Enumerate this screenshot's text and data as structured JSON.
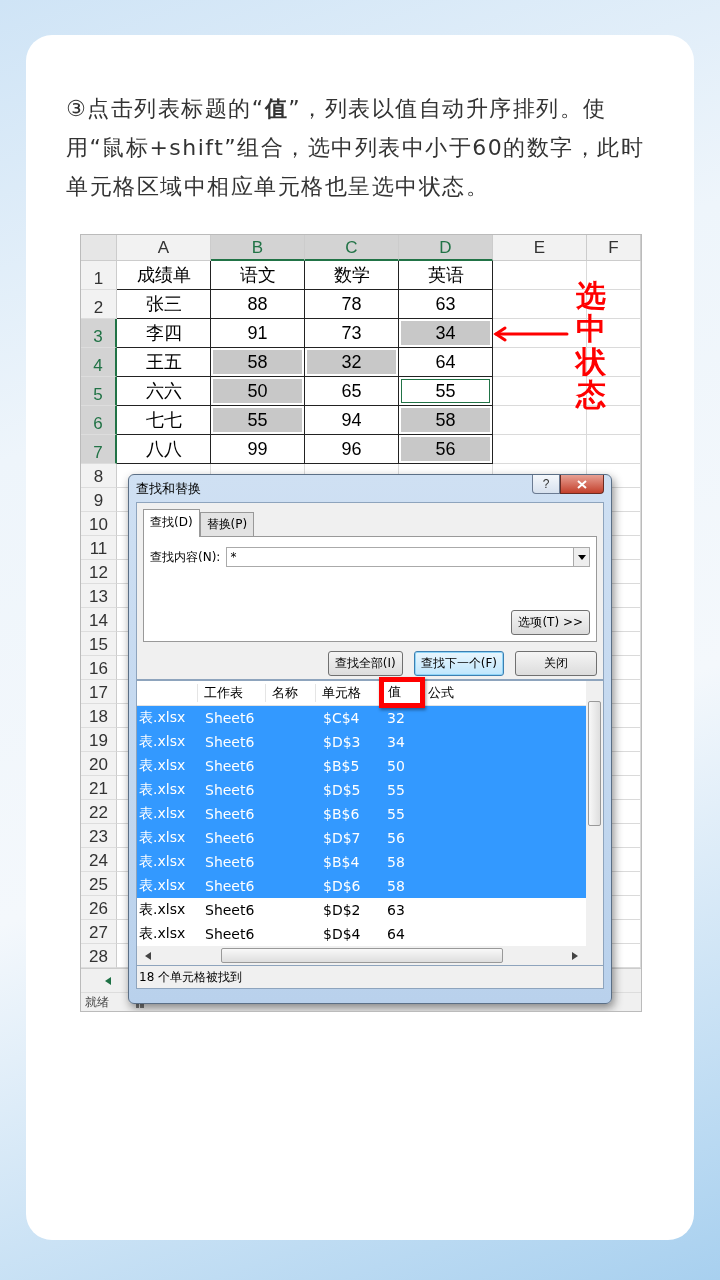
{
  "instruction": "③点击列表标题的“**值**”，列表以值自动升序排列。使用“鼠标+shift”组合，选中列表中小于60的数字，此时单元格区域中相应单元格也呈选中状态。",
  "sheet": {
    "columns": [
      {
        "label": "A",
        "selected": false
      },
      {
        "label": "B",
        "selected": true
      },
      {
        "label": "C",
        "selected": true
      },
      {
        "label": "D",
        "selected": true
      },
      {
        "label": "E",
        "selected": false
      },
      {
        "label": "F",
        "selected": false
      }
    ],
    "rows": [
      {
        "number": "1",
        "selected": false,
        "cells": [
          {
            "text": "成绩单",
            "selected": false,
            "active": false
          },
          {
            "text": "语文",
            "selected": false,
            "active": false
          },
          {
            "text": "数学",
            "selected": false,
            "active": false
          },
          {
            "text": "英语",
            "selected": false,
            "active": false
          }
        ]
      },
      {
        "number": "2",
        "selected": false,
        "cells": [
          {
            "text": "张三",
            "selected": false,
            "active": false
          },
          {
            "text": "88",
            "selected": false,
            "active": false
          },
          {
            "text": "78",
            "selected": false,
            "active": false
          },
          {
            "text": "63",
            "selected": false,
            "active": false
          }
        ]
      },
      {
        "number": "3",
        "selected": true,
        "cells": [
          {
            "text": "李四",
            "selected": false,
            "active": false
          },
          {
            "text": "91",
            "selected": false,
            "active": false
          },
          {
            "text": "73",
            "selected": false,
            "active": false
          },
          {
            "text": "34",
            "selected": true,
            "active": false
          }
        ]
      },
      {
        "number": "4",
        "selected": true,
        "cells": [
          {
            "text": "王五",
            "selected": false,
            "active": false
          },
          {
            "text": "58",
            "selected": true,
            "active": false
          },
          {
            "text": "32",
            "selected": true,
            "active": false
          },
          {
            "text": "64",
            "selected": false,
            "active": false
          }
        ]
      },
      {
        "number": "5",
        "selected": true,
        "cells": [
          {
            "text": "六六",
            "selected": false,
            "active": false
          },
          {
            "text": "50",
            "selected": true,
            "active": false
          },
          {
            "text": "65",
            "selected": false,
            "active": false
          },
          {
            "text": "55",
            "selected": false,
            "active": true
          }
        ]
      },
      {
        "number": "6",
        "selected": true,
        "cells": [
          {
            "text": "七七",
            "selected": false,
            "active": false
          },
          {
            "text": "55",
            "selected": true,
            "active": false
          },
          {
            "text": "94",
            "selected": false,
            "active": false
          },
          {
            "text": "58",
            "selected": true,
            "active": false
          }
        ]
      },
      {
        "number": "7",
        "selected": true,
        "cells": [
          {
            "text": "八八",
            "selected": false,
            "active": false
          },
          {
            "text": "99",
            "selected": false,
            "active": false
          },
          {
            "text": "96",
            "selected": false,
            "active": false
          },
          {
            "text": "56",
            "selected": true,
            "active": false
          }
        ]
      },
      {
        "number": "8",
        "selected": false
      },
      {
        "number": "9",
        "selected": false
      },
      {
        "number": "10",
        "selected": false
      },
      {
        "number": "11",
        "selected": false
      },
      {
        "number": "12",
        "selected": false
      },
      {
        "number": "13",
        "selected": false
      },
      {
        "number": "14",
        "selected": false
      },
      {
        "number": "15",
        "selected": false
      },
      {
        "number": "16",
        "selected": false
      },
      {
        "number": "17",
        "selected": false
      },
      {
        "number": "18",
        "selected": false
      },
      {
        "number": "19",
        "selected": false
      },
      {
        "number": "20",
        "selected": false
      },
      {
        "number": "21",
        "selected": false
      },
      {
        "number": "22",
        "selected": false
      },
      {
        "number": "23",
        "selected": false
      },
      {
        "number": "24",
        "selected": false
      },
      {
        "number": "25",
        "selected": false
      },
      {
        "number": "26",
        "selected": false
      },
      {
        "number": "27",
        "selected": false
      },
      {
        "number": "28",
        "selected": false
      }
    ],
    "annotation": "选中状态",
    "status": "就绪"
  },
  "dialog": {
    "title": "查找和替换",
    "help_label": "?",
    "tabs": [
      {
        "label": "查找(D)",
        "selected": true
      },
      {
        "label": "替换(P)",
        "selected": false
      }
    ],
    "find_label": "查找内容(N):",
    "find_value": "*",
    "options_button": "选项(T) >>",
    "buttons": [
      {
        "label": "查找全部(I)",
        "focused": false
      },
      {
        "label": "查找下一个(F)",
        "focused": true
      },
      {
        "label": "关闭",
        "focused": false
      }
    ],
    "results": {
      "columns": [
        {
          "label": "工作表",
          "highlighted": false
        },
        {
          "label": "名称",
          "highlighted": false
        },
        {
          "label": "单元格",
          "highlighted": false
        },
        {
          "label": "值",
          "highlighted": true
        },
        {
          "label": "公式",
          "highlighted": false
        }
      ],
      "rows": [
        {
          "book": "表.xlsx",
          "sheet": "Sheet6",
          "cell": "$C$4",
          "value": "32",
          "selected": true
        },
        {
          "book": "表.xlsx",
          "sheet": "Sheet6",
          "cell": "$D$3",
          "value": "34",
          "selected": true
        },
        {
          "book": "表.xlsx",
          "sheet": "Sheet6",
          "cell": "$B$5",
          "value": "50",
          "selected": true
        },
        {
          "book": "表.xlsx",
          "sheet": "Sheet6",
          "cell": "$D$5",
          "value": "55",
          "selected": true
        },
        {
          "book": "表.xlsx",
          "sheet": "Sheet6",
          "cell": "$B$6",
          "value": "55",
          "selected": true
        },
        {
          "book": "表.xlsx",
          "sheet": "Sheet6",
          "cell": "$D$7",
          "value": "56",
          "selected": true
        },
        {
          "book": "表.xlsx",
          "sheet": "Sheet6",
          "cell": "$B$4",
          "value": "58",
          "selected": true
        },
        {
          "book": "表.xlsx",
          "sheet": "Sheet6",
          "cell": "$D$6",
          "value": "58",
          "selected": true
        },
        {
          "book": "表.xlsx",
          "sheet": "Sheet6",
          "cell": "$D$2",
          "value": "63",
          "selected": false
        },
        {
          "book": "表.xlsx",
          "sheet": "Sheet6",
          "cell": "$D$4",
          "value": "64",
          "selected": false
        }
      ]
    },
    "status": "18 个单元格被找到"
  }
}
